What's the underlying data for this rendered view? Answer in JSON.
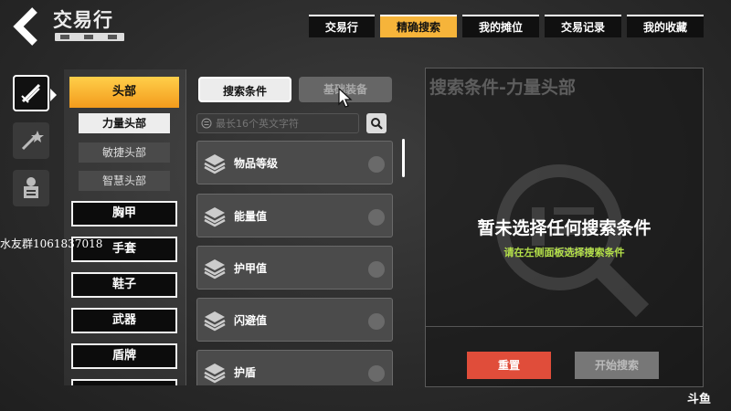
{
  "header": {
    "title": "交易行",
    "tabs": [
      {
        "label": "交易行",
        "active": false
      },
      {
        "label": "精确搜索",
        "active": true
      },
      {
        "label": "我的摊位",
        "active": false
      },
      {
        "label": "交易记录",
        "active": false
      },
      {
        "label": "我的收藏",
        "active": false
      }
    ]
  },
  "rail": {
    "icons": [
      "equipment-sword-icon",
      "equipment-magic-icon",
      "character-icon"
    ]
  },
  "categories": {
    "head": "头部",
    "sub_items": [
      {
        "label": "力量头部",
        "active": true
      },
      {
        "label": "敏捷头部",
        "active": false
      },
      {
        "label": "智慧头部",
        "active": false
      }
    ],
    "items": [
      "胸甲",
      "手套",
      "鞋子",
      "武器",
      "盾牌"
    ]
  },
  "filters": {
    "seg_active": "搜索条件",
    "seg_inactive": "基础装备",
    "search_placeholder": "最长16个英文字符",
    "items": [
      "物品等级",
      "能量值",
      "护甲值",
      "闪避值",
      "护盾"
    ]
  },
  "panel": {
    "title": "搜索条件-力量头部",
    "empty_main": "暂未选择任何搜索条件",
    "empty_sub": "请在左侧面板选择搜索条件",
    "reset_label": "重置",
    "start_label": "开始搜索"
  },
  "overlay": {
    "watermark": "水友群1061837018",
    "logo": "斗鱼"
  },
  "colors": {
    "accent": "#f6b43a",
    "reset": "#e04d3a",
    "hint_green": "#b4e04a"
  }
}
